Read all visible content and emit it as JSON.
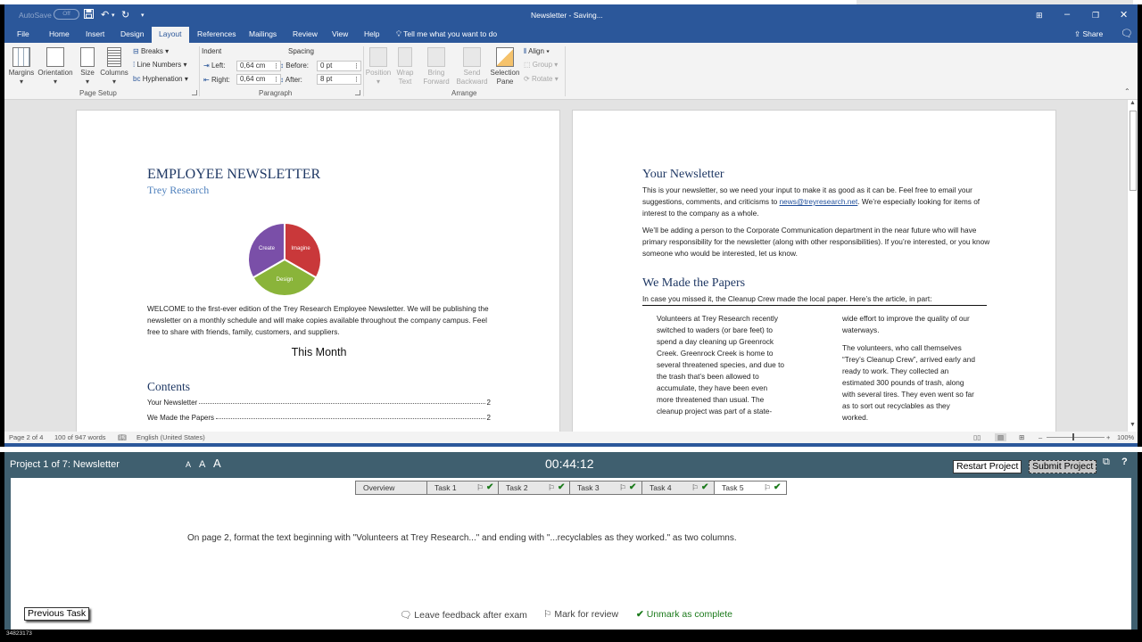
{
  "titlebar": {
    "autosave_label": "AutoSave",
    "autosave_state": "Off",
    "document_title": "Newsletter - Saving...",
    "icons": [
      "save-icon",
      "undo-icon",
      "redo-icon",
      "customize-qat-icon"
    ],
    "window_buttons": [
      "ribbon-display-options",
      "minimize",
      "restore",
      "close"
    ]
  },
  "tabs": {
    "items": [
      "File",
      "Home",
      "Insert",
      "Design",
      "Layout",
      "References",
      "Mailings",
      "Review",
      "View",
      "Help"
    ],
    "active": "Layout",
    "tell_me": "Tell me what you want to do",
    "share": "Share"
  },
  "ribbon": {
    "page_setup": {
      "label": "Page Setup",
      "margins": "Margins",
      "orientation": "Orientation",
      "size": "Size",
      "columns": "Columns",
      "breaks": "Breaks",
      "line_numbers": "Line Numbers",
      "hyphenation": "Hyphenation"
    },
    "paragraph": {
      "label": "Paragraph",
      "indent_label": "Indent",
      "spacing_label": "Spacing",
      "left_label": "Left:",
      "left_value": "0,64 cm",
      "right_label": "Right:",
      "right_value": "0,64 cm",
      "before_label": "Before:",
      "before_value": "0 pt",
      "after_label": "After:",
      "after_value": "8 pt"
    },
    "arrange": {
      "label": "Arrange",
      "position": "Position",
      "wrap_text": "Wrap Text",
      "bring_forward": "Bring Forward",
      "send_backward": "Send Backward",
      "selection_pane": "Selection Pane",
      "align": "Align",
      "group": "Group",
      "rotate": "Rotate"
    }
  },
  "page1": {
    "title": "EMPLOYEE NEWSLETTER",
    "subtitle": "Trey Research",
    "diagram": {
      "segments": [
        "Create",
        "Imagine",
        "Design"
      ],
      "colors": [
        "#7a4fa8",
        "#c9383a",
        "#8ab43a"
      ]
    },
    "welcome": "WELCOME to the first-ever edition of the Trey Research Employee Newsletter. We will be publishing the newsletter on a monthly schedule and will make copies available throughout the company campus. Feel free to share with friends, family, customers, and suppliers.",
    "this_month": "This Month",
    "contents_heading": "Contents",
    "toc": [
      {
        "title": "Your Newsletter",
        "page": "2"
      },
      {
        "title": "We Made the Papers",
        "page": "2"
      }
    ]
  },
  "page2": {
    "heading1": "Your Newsletter",
    "para1_a": "This is your newsletter, so we need your input to make it as good as it can be. Feel free to email your suggestions, comments, and criticisms to ",
    "para1_link": "news@treyresearch.net",
    "para1_b": ". We’re especially looking for items of interest to the company as a whole.",
    "para2": "We’ll be adding a person to the Corporate Communication department in the near future who will have primary responsibility for the newsletter (along with other responsibilities). If you’re interested, or you know someone who would be interested, let us know.",
    "heading2": "We Made the Papers",
    "intro": "In case you missed it, the Cleanup Crew made the local paper. Here’s the article, in part:",
    "col1": "Volunteers at Trey Research recently switched to waders (or bare feet) to spend a day cleaning up Greenrock Creek. Greenrock Creek is home to several threatened species, and due to the trash that’s been allowed to accumulate, they have been even more threatened than usual. The cleanup project was part of a state-",
    "col2_a": "wide effort to improve the quality of our waterways.",
    "col2_b": "The volunteers, who call themselves “Trey’s Cleanup Crew”, arrived early and ready to work. They collected an estimated 300 pounds of trash, along with several tires. They even went so far as to sort out recyclables as they worked."
  },
  "statusbar": {
    "page": "Page 2 of 4",
    "words": "100 of 947 words",
    "language": "English (United States)",
    "zoom": "100%"
  },
  "exam": {
    "project_title": "Project 1 of 7: Newsletter",
    "font_sizes": [
      "A",
      "A",
      "A"
    ],
    "timer": "00:44:12",
    "restart": "Restart Project",
    "submit": "Submit Project",
    "tasks": [
      {
        "label": "Overview",
        "flag": false,
        "complete": false,
        "active": false
      },
      {
        "label": "Task 1",
        "flag": true,
        "complete": true,
        "active": false
      },
      {
        "label": "Task 2",
        "flag": true,
        "complete": true,
        "active": false
      },
      {
        "label": "Task 3",
        "flag": true,
        "complete": true,
        "active": false
      },
      {
        "label": "Task 4",
        "flag": true,
        "complete": true,
        "active": false
      },
      {
        "label": "Task 5",
        "flag": true,
        "complete": true,
        "active": true
      }
    ],
    "instruction": "On page 2, format the text beginning with \"Volunteers at Trey Research...\" and ending with \"...recyclables as they worked.\" as two columns.",
    "previous_task": "Previous Task",
    "feedback": "Leave feedback after exam",
    "mark_review": "Mark for review",
    "unmark_complete": "Unmark as complete",
    "exam_id": "34823173",
    "success_color": "#1b7a1b"
  }
}
